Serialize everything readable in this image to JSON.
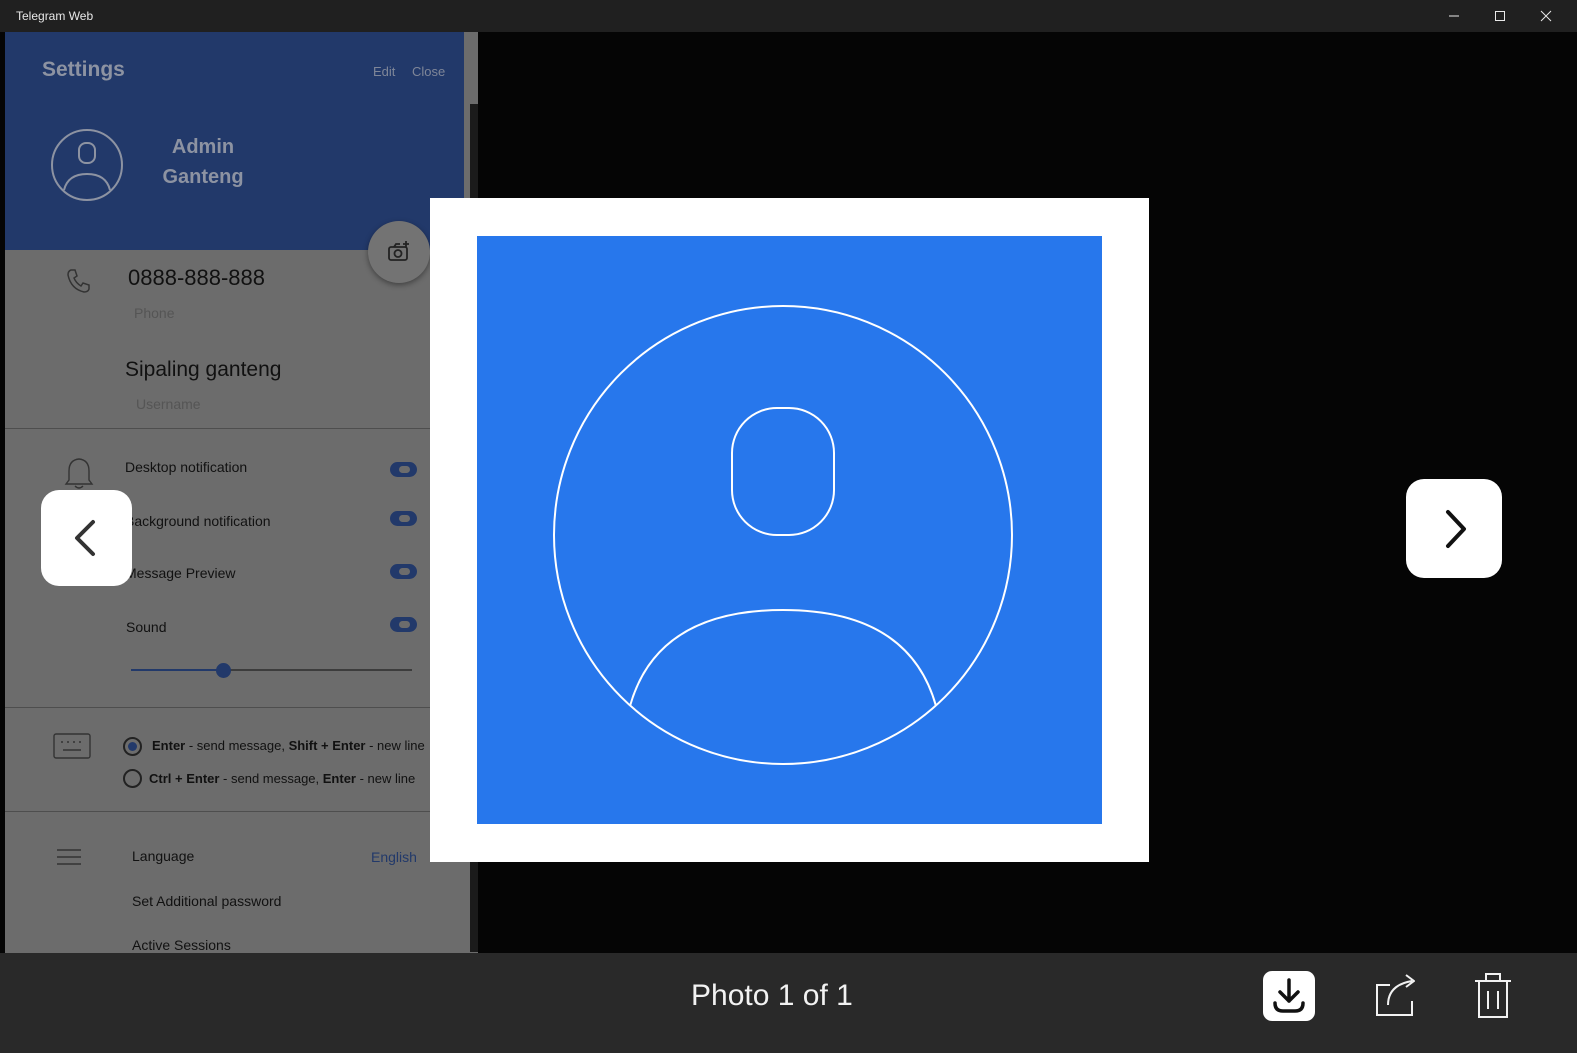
{
  "window": {
    "title": "Telegram Web"
  },
  "settings": {
    "title": "Settings",
    "edit_label": "Edit",
    "close_label": "Close",
    "profile": {
      "name": "Admin Ganteng"
    },
    "phone": {
      "value": "0888-888-888",
      "label": "Phone"
    },
    "username": {
      "value": "Sipaling ganteng",
      "label": "Username"
    },
    "notifications": [
      {
        "label": "Desktop notification",
        "on": true
      },
      {
        "label": "Background notification",
        "on": true
      },
      {
        "label": "Message Preview",
        "on": true
      },
      {
        "label": "Sound",
        "on": true
      }
    ],
    "sound_volume_fraction": 0.33,
    "send_options": [
      {
        "key1": "Enter",
        "text1": " - send message, ",
        "key2": "Shift + Enter",
        "text2": " - new line",
        "selected": true
      },
      {
        "key1": "Ctrl + Enter",
        "text1": " - send message, ",
        "key2": "Enter",
        "text2": " - new line",
        "selected": false
      }
    ],
    "language": {
      "label": "Language",
      "value": "English"
    },
    "additional_password": "Set Additional password",
    "active_sessions": "Active Sessions"
  },
  "viewer": {
    "counter": "Photo 1 of 1",
    "icons": {
      "prev": "chevron-left-icon",
      "next": "chevron-right-icon",
      "download": "download-icon",
      "share": "share-icon",
      "delete": "trash-icon"
    }
  },
  "colors": {
    "accent": "#22396a",
    "photo_background": "#2777ec",
    "overlay_text": "#f2f2f2"
  }
}
